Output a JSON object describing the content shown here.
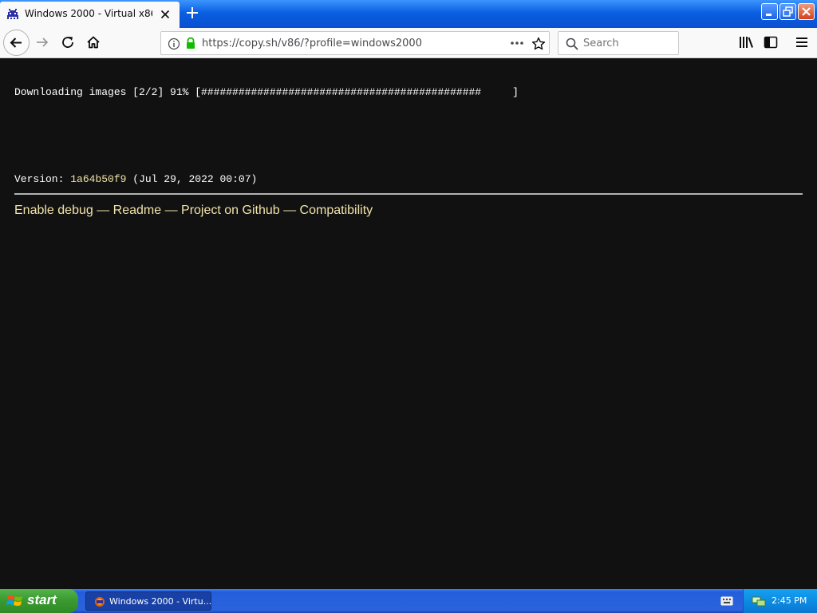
{
  "browser": {
    "tab": {
      "title": "Windows 2000 - Virtual x86",
      "favicon": "v86-invader-icon"
    },
    "window_controls": [
      "minimize-icon",
      "restore-icon",
      "close-icon"
    ],
    "url": "https://copy.sh/v86/?profile=windows2000",
    "search": {
      "placeholder": "Search",
      "value": ""
    },
    "toolbar_icons": [
      "back-arrow-icon",
      "forward-arrow-icon",
      "reload-icon",
      "home-icon",
      "library-icon",
      "sidebar-icon",
      "hamburger-menu-icon"
    ]
  },
  "page": {
    "download_status": "Downloading images [2/2] 91% [#############################################     ]",
    "download_progress": 0.91,
    "version_label": "Version:",
    "version_hash": "1a64b50f9",
    "version_date": "(Jul 29, 2022 00:07)",
    "links": [
      {
        "label": "Enable debug"
      },
      {
        "label": "Readme"
      },
      {
        "label": "Project on Github"
      },
      {
        "label": "Compatibility"
      }
    ],
    "separator": " — ",
    "colors": {
      "background": "#111111",
      "text": "#ffffff",
      "link": "#f0e3a8"
    }
  },
  "taskbar": {
    "start_label": "start",
    "items": [
      {
        "label": "Windows 2000 - Virtu..."
      }
    ],
    "clock": "2:45 PM"
  }
}
